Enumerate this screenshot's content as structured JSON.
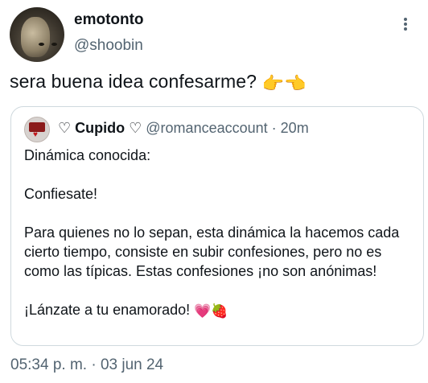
{
  "author": {
    "display_name": "emotonto",
    "handle": "@shoobin"
  },
  "tweet": {
    "text": "sera buena idea confesarme?",
    "emojis": "👉👈",
    "timestamp": "05:34 p. m. · 03 jun 24"
  },
  "quoted": {
    "name": "♡ Cupido ♡",
    "handle": "@romanceaccount",
    "separator": "·",
    "time": "20m",
    "lines": [
      "Dinámica conocida:",
      "Confiesate!",
      "Para quienes no lo sepan, esta dinámica la hacemos cada cierto tiempo, consiste en subir confesiones, pero no es como las típicas. Estas confesiones ¡no son anónimas!",
      "¡Lánzate a tu enamorado!"
    ],
    "closing_emojis": "💗🍓"
  },
  "icons": {
    "more": "more-vertical-icon"
  },
  "colors": {
    "text_primary": "#0f1419",
    "text_secondary": "#536471",
    "border": "#cfd9de"
  }
}
